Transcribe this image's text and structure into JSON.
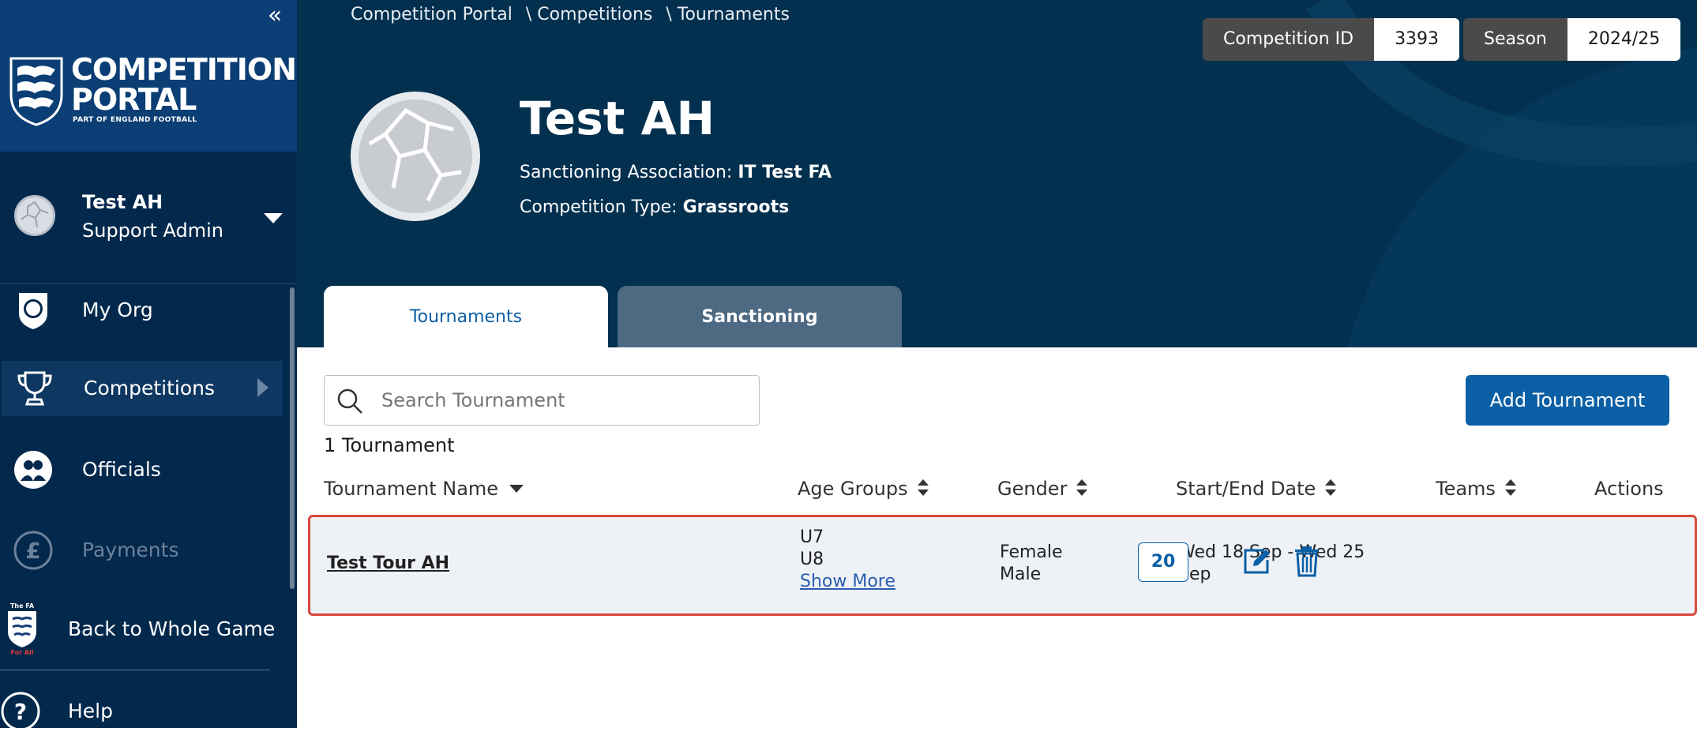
{
  "sidebar": {
    "brand": {
      "line1": "COMPETITION",
      "line2": "PORTAL",
      "tagline": "PART OF ENGLAND FOOTBALL"
    },
    "user": {
      "name": "Test AH",
      "role": "Support Admin"
    },
    "items": [
      {
        "label": "My Org",
        "icon": "org-shield-icon"
      },
      {
        "label": "Competitions",
        "icon": "trophy-icon",
        "active": true
      },
      {
        "label": "Officials",
        "icon": "officials-icon"
      },
      {
        "label": "Payments",
        "icon": "pound-icon",
        "disabled": true
      },
      {
        "label": "Back to Whole Game",
        "icon": "fa-crest-icon"
      },
      {
        "label": "Help",
        "icon": "help-icon"
      }
    ],
    "fa_crest": {
      "top": "The FA",
      "bottom": "For All"
    }
  },
  "header": {
    "breadcrumb": [
      "Competition Portal",
      "\\ Competitions",
      "\\ Tournaments"
    ],
    "competition_id": {
      "label": "Competition ID",
      "value": "3393"
    },
    "season": {
      "label": "Season",
      "value": "2024/25"
    },
    "title": "Test AH",
    "sanctioning": {
      "label": "Sanctioning Association:",
      "value": "IT Test FA"
    },
    "competition_type": {
      "label": "Competition Type:",
      "value": "Grassroots"
    },
    "tabs": [
      {
        "label": "Tournaments",
        "active": true
      },
      {
        "label": "Sanctioning",
        "active": false
      }
    ]
  },
  "main": {
    "search": {
      "placeholder": "Search Tournament"
    },
    "add_button": "Add Tournament",
    "count": "1 Tournament",
    "columns": [
      "Tournament Name",
      "Age Groups",
      "Gender",
      "Start/End Date",
      "Teams",
      "Actions"
    ],
    "rows": [
      {
        "name": "Test Tour AH",
        "age_groups": [
          "U7",
          "U8"
        ],
        "show_more": "Show More",
        "gender": [
          "Female",
          "Male"
        ],
        "date_line1": "Wed 18 Sep - Wed 25",
        "date_line2": "Sep",
        "teams": "20"
      }
    ]
  },
  "colors": {
    "sidebar_bg": "#02284c",
    "brand_bg": "#0b3e74",
    "header_bg": "#03304f",
    "primary": "#0b5fa5",
    "row_highlight_border": "#d9483b"
  }
}
